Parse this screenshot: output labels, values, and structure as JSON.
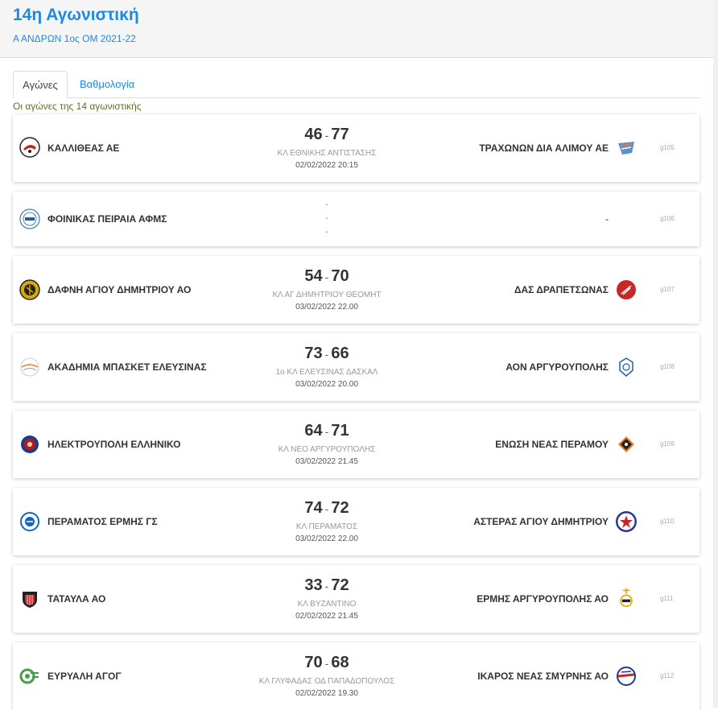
{
  "header": {
    "title": "14η Αγωνιστική",
    "subtitle": "Α ΑΝΔΡΩΝ 1ος ΟΜ 2021-22"
  },
  "tabs": [
    {
      "label": "Αγώνες"
    },
    {
      "label": "Βαθμολογία"
    }
  ],
  "caption": "Οι αγώνες της 14 αγωνιστικής",
  "matches": [
    {
      "home": "ΚΑΛΛΙΘΕΑΣ ΑΕ",
      "away": "ΤΡΑΧΩΝΩΝ ΔΙΑ ΑΛΙΜΟΥ ΑΕ",
      "home_score": "46",
      "away_score": "77",
      "sep": "-",
      "venue": "ΚΛ ΕΘΝΙΚΗΣ ΑΝΤΙΣΤΑΣΗΣ",
      "date": "02/02/2022 20:15",
      "code": "g105",
      "home_color": "#c62828",
      "away_color": "#5b8fd1"
    },
    {
      "home": "ΦΟΙΝΙΚΑΣ ΠΕΙΡΑΙΑ ΑΦΜΣ",
      "away": "-",
      "line1": "-",
      "line2": "-",
      "line3": "-",
      "code": "g106",
      "home_color": "#1e5fa8"
    },
    {
      "home": "ΔΑΦΝΗ ΑΓΙΟΥ ΔΗΜΗΤΡΙΟΥ ΑΟ",
      "away": "ΔΑΣ ΔΡΑΠΕΤΣΩΝΑΣ",
      "home_score": "54",
      "away_score": "70",
      "sep": "-",
      "venue": "ΚΛ ΑΓ ΔΗΜΗΤΡΙΟΥ ΘΕΟΜΗΤ",
      "date": "03/02/2022 22.00",
      "code": "g107",
      "home_color": "#d4a900",
      "away_color": "#c62828"
    },
    {
      "home": "ΑΚΑΔΗΜΙΑ ΜΠΑΣΚΕΤ ΕΛΕΥΣΙΝΑΣ",
      "away": "ΑΟΝ ΑΡΓΥΡΟΥΠΟΛΗΣ",
      "home_score": "73",
      "away_score": "66",
      "sep": "-",
      "venue": "1ο ΚΛ ΕΛΕΥΣΙΝΑΣ ΔΑΣΚΑΛ",
      "date": "03/02/2022 20.00",
      "code": "g108",
      "home_color": "#e67e22",
      "away_color": "#1e5fa8"
    },
    {
      "home": "ΗΛΕΚΤΡΟΥΠΟΛΗ ΕΛΛΗΝΙΚΟ",
      "away": "ΕΝΩΣΗ ΝΕΑΣ ΠΕΡΑΜΟΥ",
      "home_score": "64",
      "away_score": "71",
      "sep": "-",
      "venue": "ΚΛ ΝΕΟ ΑΡΓΥΡΟΥΠΟΛΗΣ",
      "date": "03/02/2022 21.45",
      "code": "g109",
      "home_color": "#b71c1c",
      "away_color": "#222222"
    },
    {
      "home": "ΠΕΡΑΜΑΤΟΣ ΕΡΜΗΣ ΓΣ",
      "away": "ΑΣΤΕΡΑΣ ΑΓΙΟΥ ΔΗΜΗΤΡΙΟΥ",
      "home_score": "74",
      "away_score": "72",
      "sep": "-",
      "venue": "ΚΛ ΠΕΡΑΜΑΤΟΣ",
      "date": "03/02/2022 22.00",
      "code": "g110",
      "home_color": "#1565c0",
      "away_color": "#283593"
    },
    {
      "home": "ΤΑΤΑΥΛΑ ΑΟ",
      "away": "ΕΡΜΗΣ ΑΡΓΥΡΟΥΠΟΛΗΣ ΑΟ",
      "home_score": "33",
      "away_score": "72",
      "sep": "-",
      "venue": "ΚΛ ΒΥΖΑΝΤΙΝΟ",
      "date": "02/02/2022 21.45",
      "code": "g111",
      "home_color": "#c62828",
      "away_color": "#e0b000"
    },
    {
      "home": "ΕΥΡΥΑΛΗ ΑΓΟΓ",
      "away": "ΙΚΑΡΟΣ ΝΕΑΣ ΣΜΥΡΝΗΣ ΑΟ",
      "home_score": "70",
      "away_score": "68",
      "sep": "-",
      "venue": "ΚΛ ΓΛΥΦΑΔΑΣ ΟΔ ΠΑΠΑΔΟΠΟΥΛΟΣ",
      "date": "02/02/2022 19.30",
      "code": "g112",
      "home_color": "#43a047",
      "away_color": "#1e3a8a"
    }
  ]
}
